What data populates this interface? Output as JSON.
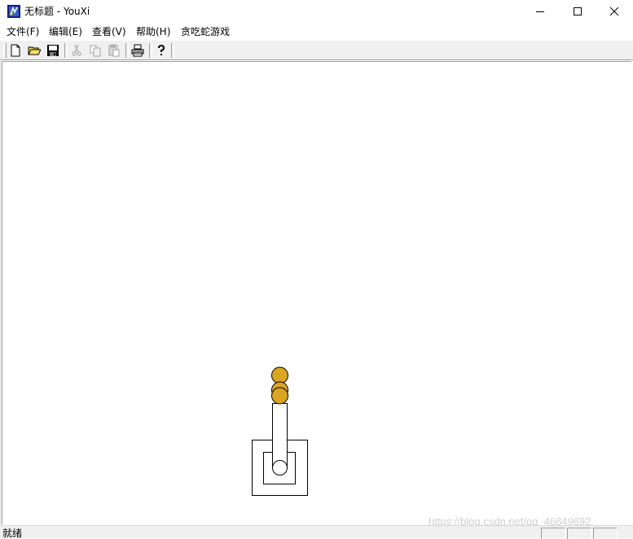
{
  "window": {
    "title": "无标题 - YouXi"
  },
  "menu": [
    "文件(F)",
    "编辑(E)",
    "查看(V)",
    "帮助(H)",
    "贪吃蛇游戏"
  ],
  "toolbar": {
    "buttons": [
      "new-file-icon",
      "open-folder-icon",
      "save-icon",
      "cut-icon",
      "copy-icon",
      "paste-icon",
      "print-icon",
      "help-icon"
    ]
  },
  "scene": {
    "ball_color": "#DAA520",
    "ball_count": 3
  },
  "status": {
    "text": "就绪"
  },
  "watermark": "https://blog.csdn.net/qq_46649692"
}
